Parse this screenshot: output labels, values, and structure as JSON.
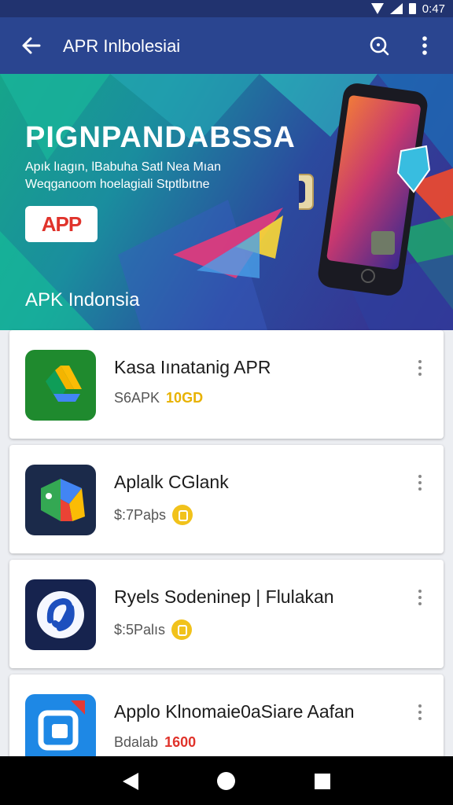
{
  "status_bar": {
    "time": "0:47"
  },
  "app_bar": {
    "title": "APR Inlbolesiai"
  },
  "banner": {
    "headline": "PIGNPANDABSSA",
    "subline_1": "Apık lıagın, lBabuha Satl Nea Mıan",
    "subline_2": "Weqganoom hoelagiali Stptlbıtne",
    "logo_text": "APP",
    "caption": "APK Indonsia"
  },
  "apps": [
    {
      "name": "Kasa Iınatanig APR",
      "meta": "S6APK",
      "badge": "10GD",
      "badge_type": "gold-text"
    },
    {
      "name": "Aplalk CGlank",
      "meta": "$:7Paþs",
      "badge": "",
      "badge_type": "coin"
    },
    {
      "name": "Ryels Sodeninep | Flulakan",
      "meta": "$:5Palıs",
      "badge": "",
      "badge_type": "coin"
    },
    {
      "name": "Applo Klnomaie0aSiare Aafan",
      "meta": "Bdalab",
      "badge": "1600",
      "badge_type": "red-text"
    }
  ],
  "icons": {
    "back": "arrow-left-icon",
    "search": "search-icon",
    "more": "more-vertical-icon",
    "nav_back": "triangle-back-icon",
    "nav_home": "circle-home-icon",
    "nav_recent": "square-recent-icon"
  },
  "colors": {
    "status_bar": "#21336f",
    "app_bar": "#2a4590",
    "accent_gold": "#e8b200",
    "accent_red": "#e0332b"
  }
}
